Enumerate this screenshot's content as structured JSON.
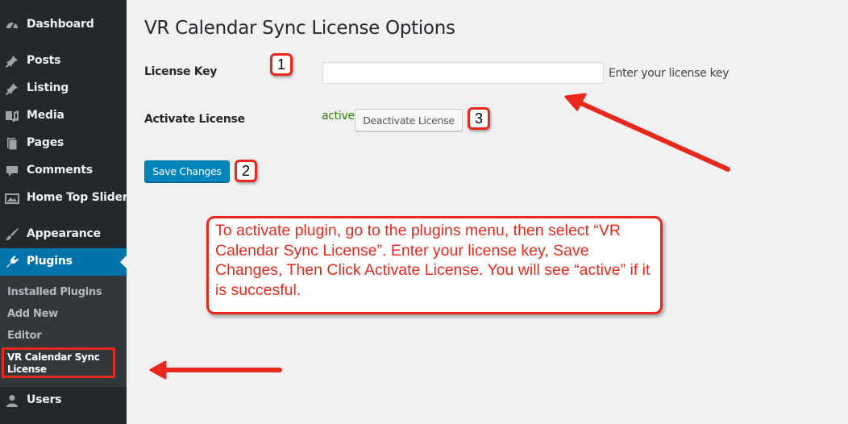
{
  "sidebar": {
    "items": [
      {
        "label": "Dashboard",
        "icon": "dashboard-icon"
      },
      {
        "label": "Posts",
        "icon": "pin-icon"
      },
      {
        "label": "Listing",
        "icon": "pin-icon"
      },
      {
        "label": "Media",
        "icon": "media-icon"
      },
      {
        "label": "Pages",
        "icon": "pages-icon"
      },
      {
        "label": "Comments",
        "icon": "comment-icon"
      },
      {
        "label": "Home Top Slider",
        "icon": "slider-icon"
      },
      {
        "label": "Appearance",
        "icon": "brush-icon"
      },
      {
        "label": "Plugins",
        "icon": "plugin-icon"
      },
      {
        "label": "Users",
        "icon": "user-icon"
      }
    ],
    "submenu": [
      "Installed Plugins",
      "Add New",
      "Editor",
      "VR Calendar Sync License"
    ]
  },
  "page": {
    "title": "VR Calendar Sync License Options",
    "license_label": "License Key",
    "license_value": "",
    "license_desc": "Enter your license key",
    "activate_label": "Activate License",
    "status": "active",
    "deactivate_label": "Deactivate License",
    "save_label": "Save Changes"
  },
  "annotations": {
    "badge1": "1",
    "badge2": "2",
    "badge3": "3",
    "callout": "To activate plugin, go to the plugins menu, then select “VR Calendar Sync License”. Enter your license key, Save Changes, Then Click Activate License. You will see “active” if it is succesful."
  },
  "colors": {
    "sidebar_bg": "#23282d",
    "submenu_bg": "#32373c",
    "accent": "#0073aa",
    "annotation_red": "#e8281c",
    "status_green": "#2a8400"
  }
}
